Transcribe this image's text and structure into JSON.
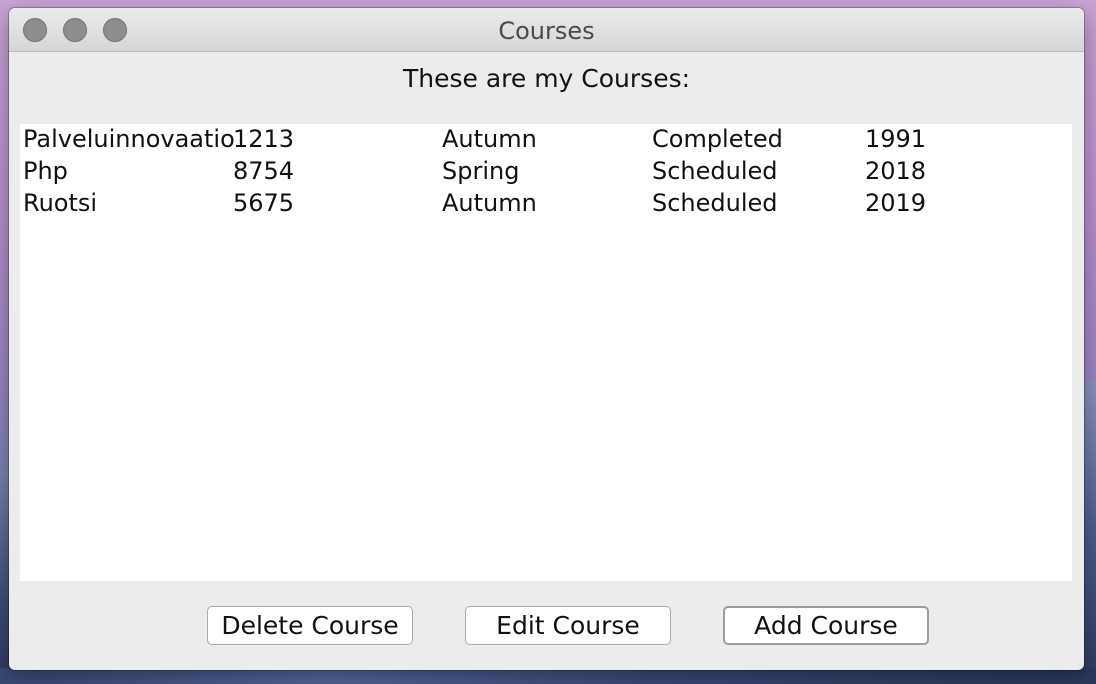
{
  "window": {
    "title": "Courses"
  },
  "heading": "These are my Courses:",
  "courses": [
    {
      "name": "Palveluinnovaatio",
      "code": "1213",
      "term": "Autumn",
      "status": "Completed",
      "year": "1991"
    },
    {
      "name": "Php",
      "code": "8754",
      "term": "Spring",
      "status": "Scheduled",
      "year": "2018"
    },
    {
      "name": "Ruotsi",
      "code": "5675",
      "term": "Autumn",
      "status": "Scheduled",
      "year": "2019"
    }
  ],
  "buttons": {
    "delete_label": "Delete Course",
    "edit_label": "Edit Course",
    "add_label": "Add Course"
  }
}
